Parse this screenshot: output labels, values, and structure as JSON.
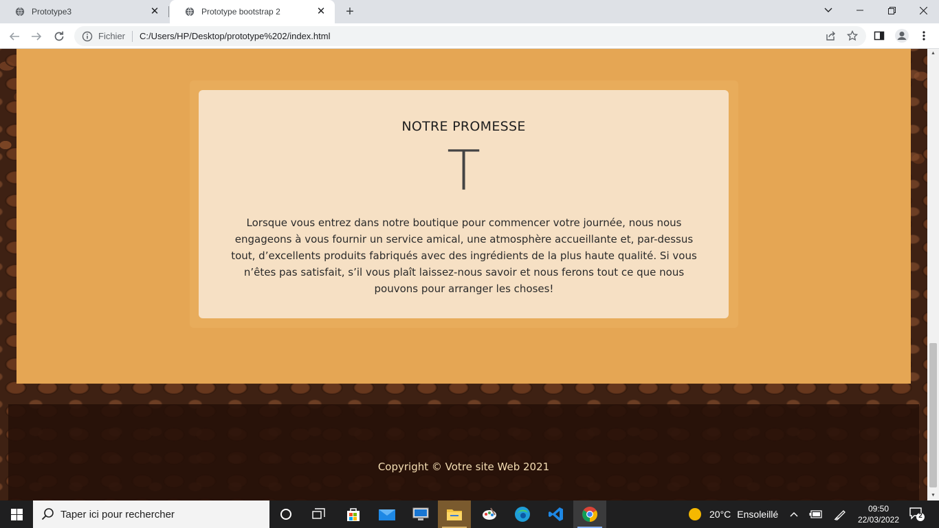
{
  "browser": {
    "tabs": [
      {
        "title": "Prototype3",
        "active": false
      },
      {
        "title": "Prototype bootstrap 2",
        "active": true
      }
    ],
    "address": {
      "scheme_label": "Fichier",
      "url": "C:/Users/HP/Desktop/prototype%202/index.html"
    }
  },
  "page": {
    "promise": {
      "heading": "NOTRE PROMESSE",
      "big_letter": "T",
      "body": "Lorsque vous entrez dans notre boutique pour commencer votre journée, nous nous engageons à vous fournir un service amical, une atmosphère accueillante et, par-dessus tout, d’excellents produits fabriqués avec des ingrédients de la plus haute qualité. Si vous n’êtes pas satisfait, s’il vous plaît laissez-nous savoir et nous ferons tout ce que nous pouvons pour arranger les choses!"
    },
    "footer": {
      "copyright": "Copyright © Votre site Web 2021"
    },
    "colors": {
      "section_bg": "#e5a654",
      "card_bg": "#f6e0c4",
      "footer_text": "#f5deb3"
    }
  },
  "taskbar": {
    "search_placeholder": "Taper ici pour rechercher",
    "weather": {
      "temp": "20°C",
      "condition": "Ensoleillé"
    },
    "clock": {
      "time": "09:50",
      "date": "22/03/2022"
    },
    "notification_count": "2",
    "pinned_icons": [
      "task-view-icon",
      "store-icon",
      "mail-icon",
      "remote-desktop-icon",
      "file-explorer-icon",
      "paint-icon",
      "edge-icon",
      "vscode-icon",
      "chrome-icon"
    ]
  }
}
